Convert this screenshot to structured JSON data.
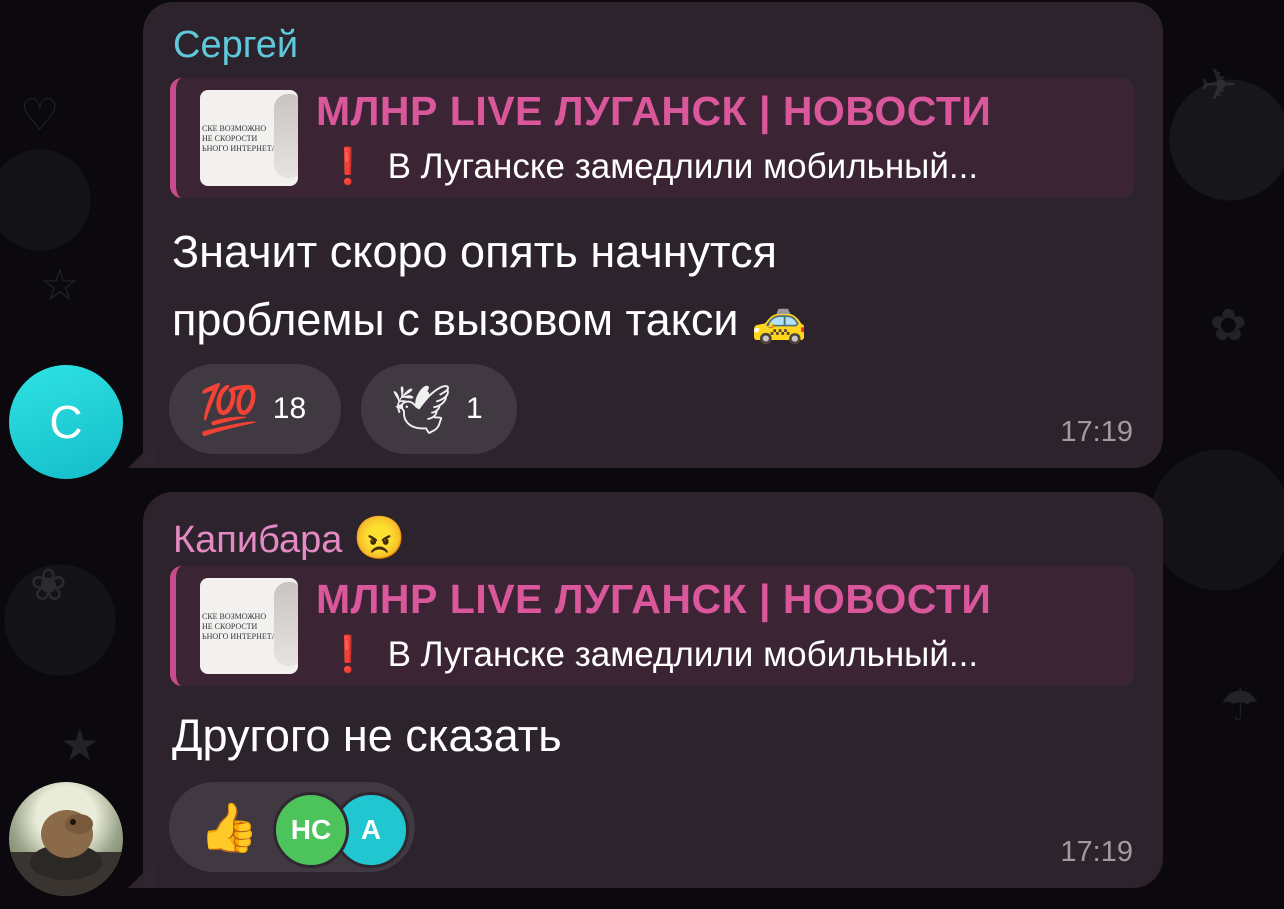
{
  "messages": [
    {
      "sender": "Сергей",
      "sender_color": "#5fc9dc",
      "avatar_letter": "С",
      "reply": {
        "title": "МЛНР LIVE ЛУГАНСК | НОВОСТИ",
        "text": "В Луганске замедлили мобильный...",
        "excl": "❗",
        "thumb_text": "СКЕ ВОЗМОЖНО\nНЕ СКОРОСТИ\nЬНОГО ИНТЕРНЕТА"
      },
      "text_line1": "Значит скоро опять начнутся",
      "text_line2": "проблемы с вызовом такси 🚕",
      "reactions": [
        {
          "emoji": "💯",
          "count": "18"
        },
        {
          "emoji": "🕊",
          "count": "1"
        }
      ],
      "time": "17:19"
    },
    {
      "sender": "Капибара",
      "sender_emoji": "😠",
      "sender_color": "#e48ac2",
      "reply": {
        "title": "МЛНР LIVE ЛУГАНСК | НОВОСТИ",
        "text": "В Луганске замедлили мобильный...",
        "excl": "❗",
        "thumb_text": "СКЕ ВОЗМОЖНО\nНЕ СКОРОСТИ\nЬНОГО ИНТЕРНЕТА"
      },
      "text": "Другого не сказать",
      "reactions": [
        {
          "emoji": "👍",
          "avatars": [
            "НС",
            "A"
          ]
        }
      ],
      "time": "17:19"
    }
  ],
  "colors": {
    "accent_reply": "#d9579a",
    "avatar_c": "#21d0d6",
    "mini_avatar_ns": "#4cc35b",
    "mini_avatar_a": "#20c6d0"
  }
}
